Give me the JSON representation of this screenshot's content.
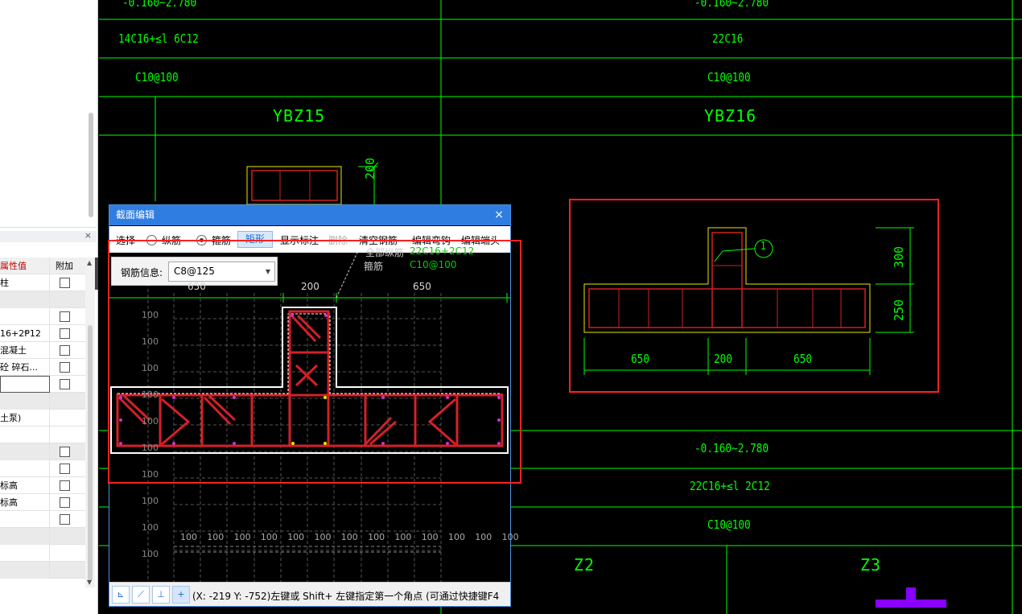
{
  "left_panel": {
    "close_glyph": "×",
    "columns": {
      "value": "属性值",
      "extra": "附加"
    },
    "rows": [
      {
        "value": "柱",
        "check": true,
        "grey": false
      },
      {
        "value": "",
        "check": false,
        "grey": true
      },
      {
        "value": "",
        "check": true,
        "grey": false
      },
      {
        "value": "16+2Ᵽ12",
        "check": true,
        "grey": false
      },
      {
        "value": "混凝土",
        "check": true,
        "grey": false
      },
      {
        "value": "砼 碎石...",
        "check": true,
        "grey": false
      },
      {
        "value": "",
        "check": true,
        "grey": false,
        "input": true
      },
      {
        "value": "",
        "check": false,
        "grey": true
      },
      {
        "value": "土泵)",
        "check": false,
        "grey": false
      },
      {
        "value": "",
        "check": false,
        "grey": false
      },
      {
        "value": "",
        "check": true,
        "grey": true
      },
      {
        "value": "",
        "check": true,
        "grey": false
      },
      {
        "value": "标高",
        "check": true,
        "grey": false
      },
      {
        "value": "标高",
        "check": true,
        "grey": false
      },
      {
        "value": "",
        "check": true,
        "grey": false
      },
      {
        "value": "",
        "check": false,
        "grey": true
      },
      {
        "value": "",
        "check": false,
        "grey": false
      },
      {
        "value": "",
        "check": false,
        "grey": true
      }
    ]
  },
  "drawing": {
    "elev_top_left": "-0.160~2.780",
    "elev_top_right": "-0.160~2.780",
    "rebar_left": "14C16+≤l 6C12",
    "rebar_right": "22C16",
    "stirrup_left": "C10@100",
    "stirrup_right": "C10@100",
    "name_left": "YBZ15",
    "name_right": "YBZ16",
    "dim_200_top": "200",
    "right_dims": {
      "d650a": "650",
      "d200": "200",
      "d650b": "650",
      "d300": "300",
      "d250": "250",
      "marker": "1"
    },
    "bottom": {
      "elev": "-0.160~2.780",
      "rebar": "22C16+≤l 2C12",
      "stirrup": "C10@100",
      "z2": "Z2",
      "z3": "Z3"
    }
  },
  "dialog": {
    "title": "截面编辑",
    "close": "×",
    "toolbar": {
      "select": "选择",
      "longitudinal": "纵筋",
      "stirrup": "箍筋",
      "rect": "矩形",
      "show_marks": "显示标注",
      "delete": "删除",
      "clear": "清空钢筋",
      "edit_hook": "编辑弯钩",
      "edit_end": "编辑端头"
    },
    "rebar_info_label": "钢筋信息:",
    "rebar_info_value": "C8@125",
    "overlay_label_1": "全部纵筋",
    "overlay_value_1": "22C16+2C12",
    "overlay_label_2": "箍筋",
    "overlay_value_2": "C10@100",
    "dims": {
      "d650a": "650",
      "d200": "200",
      "d650b": "650"
    },
    "grid_labels": [
      "100",
      "100",
      "100",
      "100",
      "100",
      "100",
      "100",
      "100",
      "100",
      "100"
    ],
    "grid_bottom_labels": [
      "100",
      "100",
      "100",
      "100",
      "100",
      "100",
      "100",
      "100",
      "100",
      "100",
      "100",
      "100",
      "100"
    ],
    "status_text": "(X: -219 Y: -752)左键或 Shift+ 左键指定第一个角点 (可通过快捷键F4"
  }
}
